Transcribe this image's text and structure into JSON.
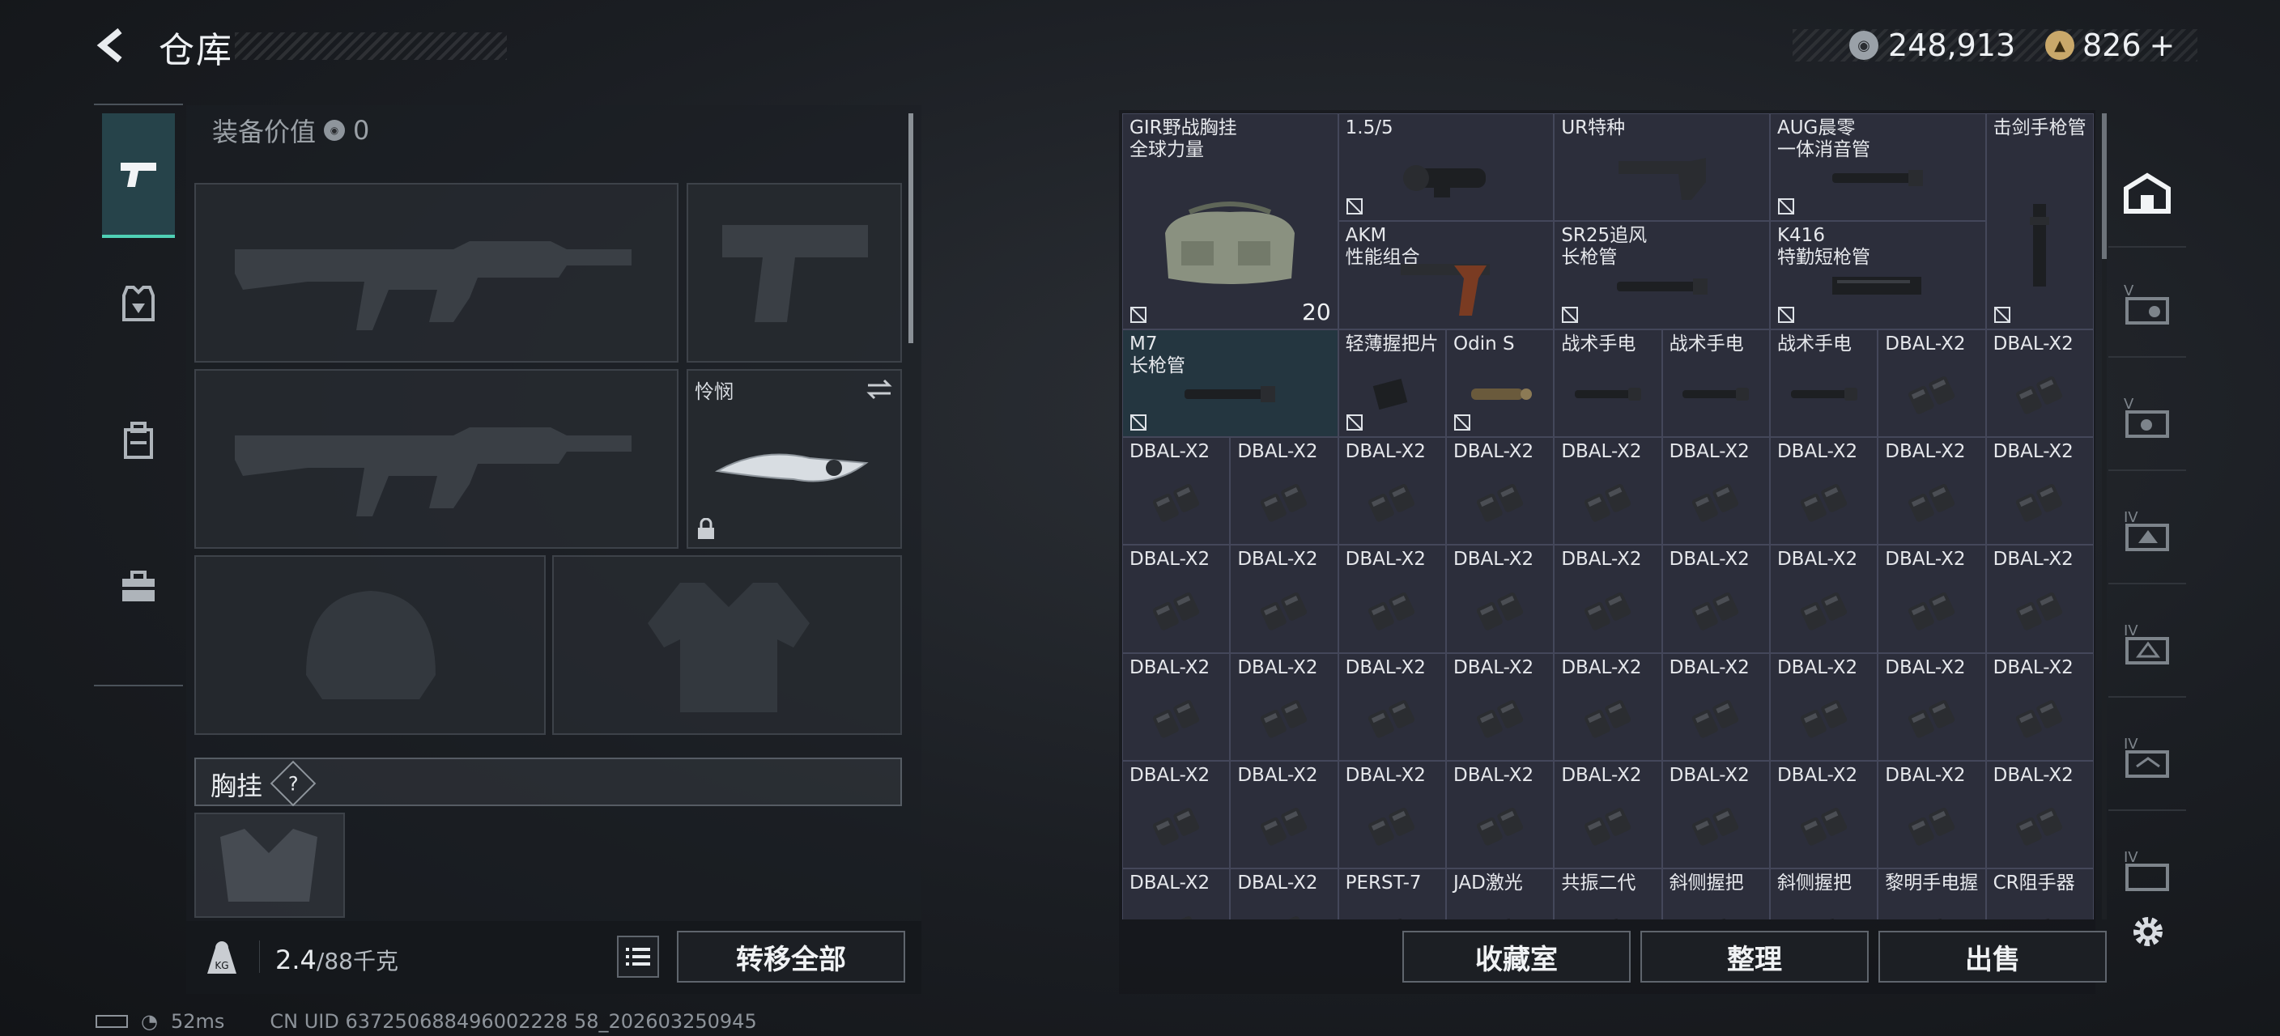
{
  "header": {
    "title": "仓库",
    "currency_primary": "248,913",
    "currency_secondary": "826",
    "currency_add": "+"
  },
  "left": {
    "equip_value_label": "装备价值",
    "equip_value": "0",
    "melee_slot_label": "怜悯",
    "section_title": "胸挂",
    "section_help": "?",
    "weight_current": "2.4",
    "weight_max": "/88千克",
    "weight_badge": "KG",
    "transfer_all": "转移全部"
  },
  "grid": {
    "items": [
      {
        "name": "GIR野战胸挂\n全球力量",
        "count": "20",
        "kind": "bag"
      },
      {
        "name": "1.5/5",
        "kind": "scope"
      },
      {
        "name": "UR特种",
        "kind": "stock"
      },
      {
        "name": "AUG晨零\n一体消音管",
        "kind": "barrel"
      },
      {
        "name": "击剑手枪管",
        "kind": "vbarrel"
      },
      {
        "name": "AKM\n性能组合",
        "kind": "grip"
      },
      {
        "name": "SR25追风\n长枪管",
        "kind": "barrel"
      },
      {
        "name": "K416\n特勤短枪管",
        "kind": "rail"
      },
      {
        "name": "M7\n长枪管",
        "kind": "barrel"
      },
      {
        "name": "轻薄握把片",
        "kind": "small"
      },
      {
        "name": "Odin S",
        "kind": "light"
      },
      {
        "name": "战术手电",
        "kind": "flashlight"
      },
      {
        "name": "战术手电",
        "kind": "flashlight"
      },
      {
        "name": "战术手电",
        "kind": "flashlight"
      },
      {
        "name": "DBAL-X2",
        "kind": "dbal"
      },
      {
        "name": "DBAL-X2",
        "kind": "dbal"
      },
      {
        "name": "DBAL-X2",
        "kind": "dbal"
      },
      {
        "name": "DBAL-X2",
        "kind": "dbal"
      },
      {
        "name": "DBAL-X2",
        "kind": "dbal"
      },
      {
        "name": "DBAL-X2",
        "kind": "dbal"
      },
      {
        "name": "DBAL-X2",
        "kind": "dbal"
      },
      {
        "name": "DBAL-X2",
        "kind": "dbal"
      },
      {
        "name": "DBAL-X2",
        "kind": "dbal"
      },
      {
        "name": "DBAL-X2",
        "kind": "dbal"
      },
      {
        "name": "DBAL-X2",
        "kind": "dbal"
      },
      {
        "name": "DBAL-X2",
        "kind": "dbal"
      },
      {
        "name": "DBAL-X2",
        "kind": "dbal"
      },
      {
        "name": "DBAL-X2",
        "kind": "dbal"
      },
      {
        "name": "DBAL-X2",
        "kind": "dbal"
      },
      {
        "name": "DBAL-X2",
        "kind": "dbal"
      },
      {
        "name": "DBAL-X2",
        "kind": "dbal"
      },
      {
        "name": "DBAL-X2",
        "kind": "dbal"
      },
      {
        "name": "DBAL-X2",
        "kind": "dbal"
      },
      {
        "name": "DBAL-X2",
        "kind": "dbal"
      },
      {
        "name": "DBAL-X2",
        "kind": "dbal"
      },
      {
        "name": "DBAL-X2",
        "kind": "dbal"
      },
      {
        "name": "DBAL-X2",
        "kind": "dbal"
      },
      {
        "name": "DBAL-X2",
        "kind": "dbal"
      },
      {
        "name": "DBAL-X2",
        "kind": "dbal"
      },
      {
        "name": "DBAL-X2",
        "kind": "dbal"
      },
      {
        "name": "DBAL-X2",
        "kind": "dbal"
      },
      {
        "name": "DBAL-X2",
        "kind": "dbal"
      },
      {
        "name": "DBAL-X2",
        "kind": "dbal"
      },
      {
        "name": "DBAL-X2",
        "kind": "dbal"
      },
      {
        "name": "DBAL-X2",
        "kind": "dbal"
      },
      {
        "name": "DBAL-X2",
        "kind": "dbal"
      },
      {
        "name": "DBAL-X2",
        "kind": "dbal"
      },
      {
        "name": "DBAL-X2",
        "kind": "dbal"
      },
      {
        "name": "DBAL-X2",
        "kind": "dbal"
      },
      {
        "name": "DBAL-X2",
        "kind": "dbal"
      },
      {
        "name": "DBAL-X2",
        "kind": "dbal"
      },
      {
        "name": "DBAL-X2",
        "kind": "dbal"
      },
      {
        "name": "DBAL-X2",
        "kind": "dbal"
      },
      {
        "name": "DBAL-X2",
        "kind": "dbal"
      },
      {
        "name": "PERST-7",
        "kind": "small"
      },
      {
        "name": "JAD激光",
        "kind": "small"
      },
      {
        "name": "共振二代",
        "kind": "small"
      },
      {
        "name": "斜侧握把",
        "kind": "small"
      },
      {
        "name": "斜侧握把",
        "kind": "small"
      },
      {
        "name": "黎明手电握",
        "kind": "small"
      },
      {
        "name": "CR阻手器",
        "kind": "small"
      }
    ]
  },
  "actions": {
    "collection": "收藏室",
    "sort": "整理",
    "sell": "出售"
  },
  "status": {
    "ping": "52ms",
    "uid": "CN UID 637250688496002228 58_202603250945"
  },
  "colors": {
    "accent": "#4fd0b5",
    "cell_bg": "#2c2e3b",
    "cell_highlight": "#243640"
  }
}
